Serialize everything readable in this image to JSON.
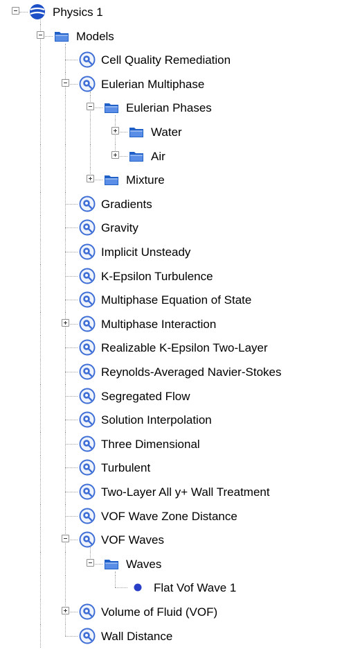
{
  "tree": [
    {
      "label": "Physics 1",
      "depth": 0,
      "icon": "physics-sphere-icon",
      "toggle": "minus",
      "last": false
    },
    {
      "label": "Models",
      "depth": 1,
      "icon": "folder-icon",
      "toggle": "minus",
      "last": false
    },
    {
      "label": "Cell Quality Remediation",
      "depth": 2,
      "icon": "model-icon",
      "toggle": "none",
      "last": false
    },
    {
      "label": "Eulerian Multiphase",
      "depth": 2,
      "icon": "model-icon",
      "toggle": "minus",
      "last": false
    },
    {
      "label": "Eulerian Phases",
      "depth": 3,
      "icon": "folder-icon",
      "toggle": "minus",
      "last": false
    },
    {
      "label": "Water",
      "depth": 4,
      "icon": "folder-icon",
      "toggle": "plus",
      "last": false
    },
    {
      "label": "Air",
      "depth": 4,
      "icon": "folder-icon",
      "toggle": "plus",
      "last": true
    },
    {
      "label": "Mixture",
      "depth": 3,
      "icon": "folder-icon",
      "toggle": "plus",
      "last": true
    },
    {
      "label": "Gradients",
      "depth": 2,
      "icon": "model-icon",
      "toggle": "none",
      "last": false
    },
    {
      "label": "Gravity",
      "depth": 2,
      "icon": "model-icon",
      "toggle": "none",
      "last": false
    },
    {
      "label": "Implicit Unsteady",
      "depth": 2,
      "icon": "model-icon",
      "toggle": "none",
      "last": false
    },
    {
      "label": "K-Epsilon Turbulence",
      "depth": 2,
      "icon": "model-icon",
      "toggle": "none",
      "last": false
    },
    {
      "label": "Multiphase Equation of State",
      "depth": 2,
      "icon": "model-icon",
      "toggle": "none",
      "last": false
    },
    {
      "label": "Multiphase Interaction",
      "depth": 2,
      "icon": "model-icon",
      "toggle": "plus",
      "last": false
    },
    {
      "label": "Realizable K-Epsilon Two-Layer",
      "depth": 2,
      "icon": "model-icon",
      "toggle": "none",
      "last": false
    },
    {
      "label": "Reynolds-Averaged Navier-Stokes",
      "depth": 2,
      "icon": "model-icon",
      "toggle": "none",
      "last": false
    },
    {
      "label": "Segregated Flow",
      "depth": 2,
      "icon": "model-icon",
      "toggle": "none",
      "last": false
    },
    {
      "label": "Solution Interpolation",
      "depth": 2,
      "icon": "model-icon",
      "toggle": "none",
      "last": false
    },
    {
      "label": "Three Dimensional",
      "depth": 2,
      "icon": "model-icon",
      "toggle": "none",
      "last": false
    },
    {
      "label": "Turbulent",
      "depth": 2,
      "icon": "model-icon",
      "toggle": "none",
      "last": false
    },
    {
      "label": "Two-Layer All y+ Wall Treatment",
      "depth": 2,
      "icon": "model-icon",
      "toggle": "none",
      "last": false
    },
    {
      "label": "VOF Wave Zone Distance",
      "depth": 2,
      "icon": "model-icon",
      "toggle": "none",
      "last": false
    },
    {
      "label": "VOF Waves",
      "depth": 2,
      "icon": "model-icon",
      "toggle": "minus",
      "last": false
    },
    {
      "label": "Waves",
      "depth": 3,
      "icon": "folder-icon",
      "toggle": "minus",
      "last": true
    },
    {
      "label": "Flat Vof Wave 1",
      "depth": 4,
      "icon": "wave-dot-icon",
      "toggle": "none",
      "last": true
    },
    {
      "label": "Volume of Fluid (VOF)",
      "depth": 2,
      "icon": "model-icon",
      "toggle": "plus",
      "last": false
    },
    {
      "label": "Wall Distance",
      "depth": 2,
      "icon": "model-icon",
      "toggle": "none",
      "last": true
    }
  ],
  "colors": {
    "folder": "#1f5fc8",
    "folder_light": "#5a8ee6",
    "model_ring": "#3f6fd6",
    "sphere": "#1d4fc7",
    "dot": "#2a3fc8"
  }
}
